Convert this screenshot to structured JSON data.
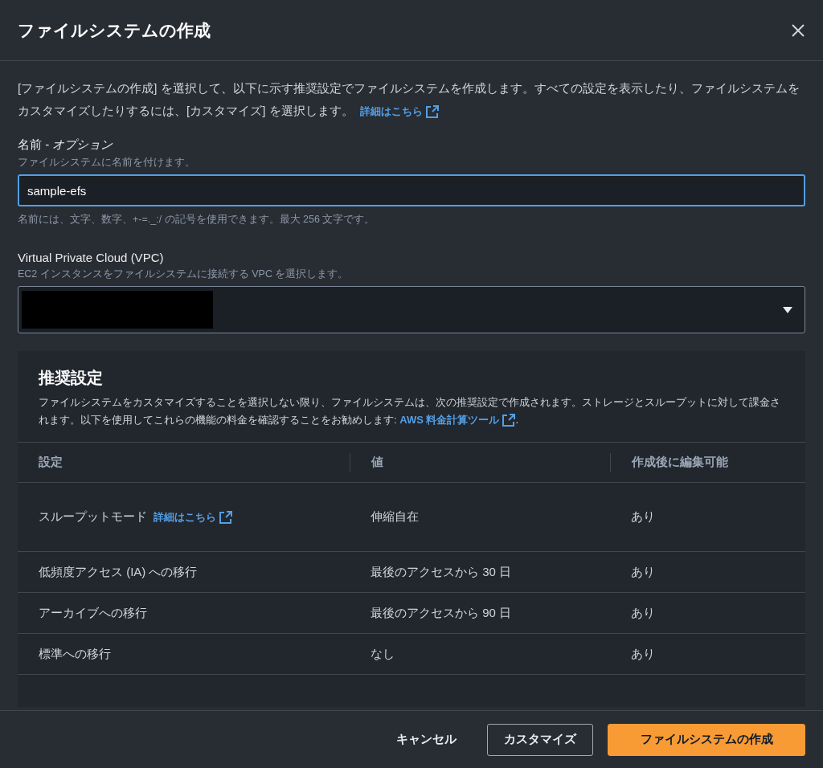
{
  "dialog": {
    "title": "ファイルシステムの作成",
    "description": "[ファイルシステムの作成] を選択して、以下に示す推奨設定でファイルシステムを作成します。すべての設定を表示したり、ファイルシステムをカスタマイズしたりするには、[カスタマイズ] を選択します。",
    "description_link": "詳細はこちら"
  },
  "name_field": {
    "label": "名前 - *オプション*",
    "hint": "ファイルシステムに名前を付けます。",
    "value": "sample-efs",
    "focused": true,
    "help": "名前には、文字、数字、+-=._:/ の記号を使用できます。最大 256 文字です。"
  },
  "vpc_field": {
    "label": "Virtual Private Cloud (VPC)",
    "hint": "EC2 インスタンスをファイルシステムに接続する VPC を選択します。",
    "redacted": true
  },
  "recommended": {
    "title": "推奨設定",
    "description": "ファイルシステムをカスタマイズすることを選択しない限り、ファイルシステムは、次の推奨設定で作成されます。ストレージとスループットに対して課金されます。以下を使用してこれらの機能の料金を確認することをお勧めします: ",
    "link": "AWS 料金計算ツール",
    "tail": ".",
    "columns": [
      "設定",
      "値",
      "作成後に編集可能"
    ],
    "rows": [
      {
        "setting": "スループットモード",
        "link": "詳細はこちら",
        "value": "伸縮自在",
        "editable": "あり"
      },
      {
        "setting": "低頻度アクセス (IA) への移行",
        "value": "最後のアクセスから 30 日",
        "editable": "あり"
      },
      {
        "setting": "アーカイブへの移行",
        "value": "最後のアクセスから 90 日",
        "editable": "あり"
      },
      {
        "setting": "標準への移行",
        "value": "なし",
        "editable": "あり"
      }
    ]
  },
  "buttons": [
    {
      "label": "キャンセル",
      "kind": "link"
    },
    {
      "label": "カスタマイズ",
      "kind": "normal"
    },
    {
      "label": "ファイルシステムの作成",
      "kind": "primary"
    }
  ]
}
